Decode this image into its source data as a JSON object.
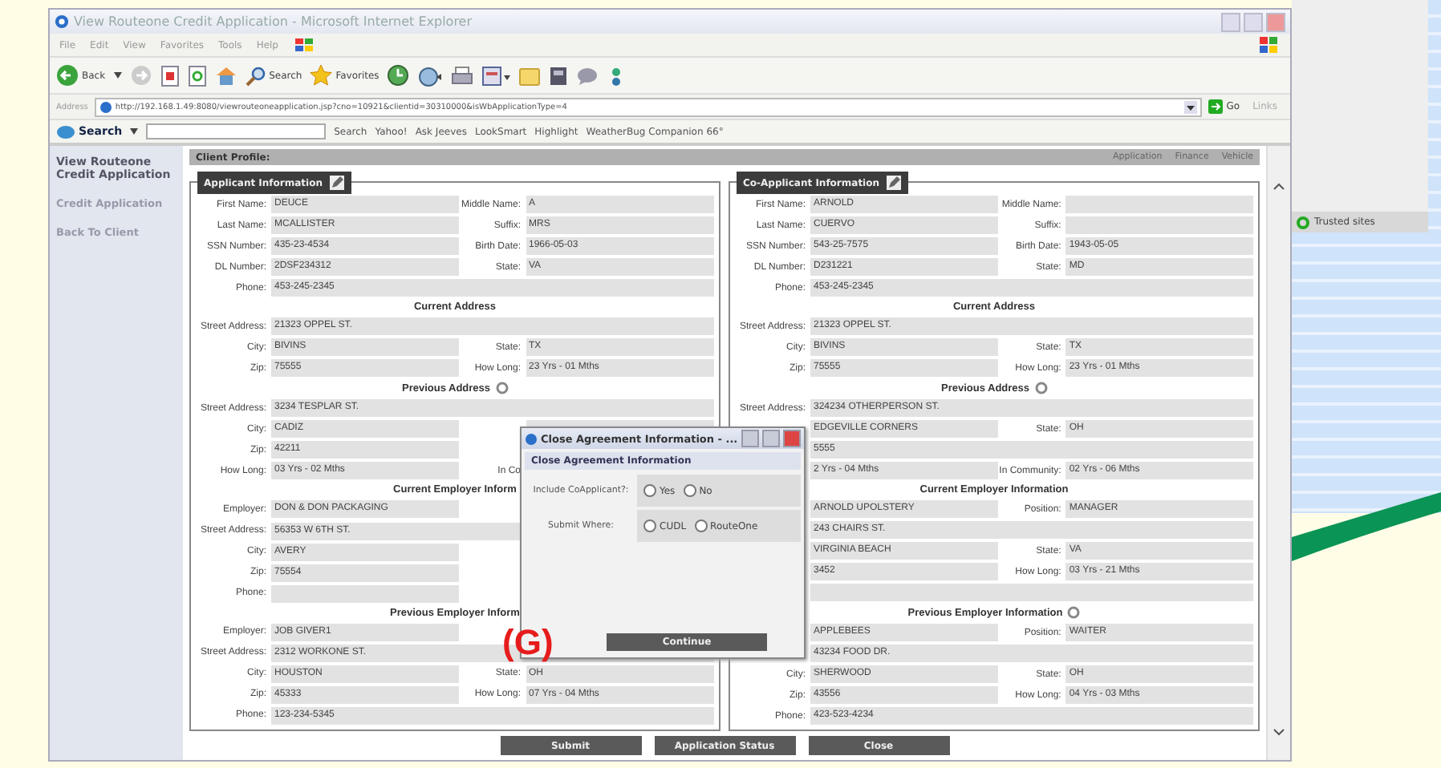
{
  "annotation": "(G)",
  "window": {
    "title": "View Routeone Credit Application - Microsoft Internet Explorer"
  },
  "menu": [
    "File",
    "Edit",
    "View",
    "Favorites",
    "Tools",
    "Help"
  ],
  "toolbar": {
    "back": "Back",
    "search": "Search",
    "favorites": "Favorites"
  },
  "address_bar": {
    "label": "Address",
    "url": "http://192.168.1.49:8080/viewrouteoneapplication.jsp?cno=10921&clientid=30310000&isWbApplicationType=4",
    "go": "Go",
    "links": "Links"
  },
  "search_toolbar": {
    "brand": "Search",
    "items": [
      "Search",
      "Yahoo!",
      "Ask Jeeves",
      "LookSmart",
      "Highlight",
      "WeatherBug Companion 66°"
    ]
  },
  "sidebar": {
    "title": "View Routeone Credit Application",
    "items": [
      {
        "label": "Credit Application"
      },
      {
        "label": "Back To Client"
      }
    ]
  },
  "header": {
    "title": "Client Profile:",
    "links": [
      "Application",
      "Finance",
      "Vehicle"
    ]
  },
  "panels": [
    {
      "title": "Applicant Information",
      "rows": [
        {
          "kind": "pair",
          "label": "First Name:",
          "value": "DEUCE",
          "label2": "Middle Name:",
          "value2": "A"
        },
        {
          "kind": "pair",
          "label": "Last Name:",
          "value": "MCALLISTER",
          "label2": "Suffix:",
          "value2": "MRS"
        },
        {
          "kind": "pair",
          "label": "SSN Number:",
          "value": "435-23-4534",
          "label2": "Birth Date:",
          "value2": "1966-05-03"
        },
        {
          "kind": "pair",
          "label": "DL Number:",
          "value": "2DSF234312",
          "label2": "State:",
          "value2": "VA"
        },
        {
          "kind": "single",
          "label": "Phone:",
          "value": "453-245-2345"
        },
        {
          "kind": "heading",
          "text": "Current Address",
          "has_icon": false
        },
        {
          "kind": "single",
          "label": "Street Address:",
          "value": "21323 OPPEL ST."
        },
        {
          "kind": "pair",
          "label": "City:",
          "value": "BIVINS",
          "label2": "State:",
          "value2": "TX"
        },
        {
          "kind": "pair",
          "label": "Zip:",
          "value": "75555",
          "label2": "How Long:",
          "value2": "23 Yrs - 01 Mths"
        },
        {
          "kind": "heading",
          "text": "Previous Address",
          "has_icon": true
        },
        {
          "kind": "single",
          "label": "Street Address:",
          "value": "3234 TESPLAR ST."
        },
        {
          "kind": "pair",
          "label": "City:",
          "value": "CADIZ"
        },
        {
          "kind": "pair",
          "label": "Zip:",
          "value": "42211"
        },
        {
          "kind": "pair",
          "label": "How Long:",
          "value": "03 Yrs - 02 Mths",
          "label2": "In Co"
        },
        {
          "kind": "heading",
          "text": "Current Employer Inform"
        },
        {
          "kind": "pair",
          "label": "Employer:",
          "value": "DON & DON PACKAGING"
        },
        {
          "kind": "single",
          "label": "Street Address:",
          "value": "56353 W 6TH ST."
        },
        {
          "kind": "pair",
          "label": "City:",
          "value": "AVERY"
        },
        {
          "kind": "pair",
          "label": "Zip:",
          "value": "75554"
        },
        {
          "kind": "pair",
          "label": "Phone:"
        },
        {
          "kind": "heading",
          "text": "Previous Employer Inform"
        },
        {
          "kind": "pair",
          "label": "Employer:",
          "value": "JOB GIVER1"
        },
        {
          "kind": "single",
          "label": "Street Address:",
          "value": "2312 WORKONE ST."
        },
        {
          "kind": "pair",
          "label": "City:",
          "value": "HOUSTON",
          "label2": "State:",
          "value2": "OH"
        },
        {
          "kind": "pair",
          "label": "Zip:",
          "value": "45333",
          "label2": "How Long:",
          "value2": "07 Yrs - 04 Mths"
        },
        {
          "kind": "single",
          "label": "Phone:",
          "value": "123-234-5345"
        }
      ]
    },
    {
      "title": "Co-Applicant Information",
      "rows": [
        {
          "kind": "pair",
          "label": "First Name:",
          "value": "ARNOLD",
          "label2": "Middle Name:"
        },
        {
          "kind": "pair",
          "label": "Last Name:",
          "value": "CUERVO",
          "label2": "Suffix:"
        },
        {
          "kind": "pair",
          "label": "SSN Number:",
          "value": "543-25-7575",
          "label2": "Birth Date:",
          "value2": "1943-05-05"
        },
        {
          "kind": "pair",
          "label": "DL Number:",
          "value": "D231221",
          "label2": "State:",
          "value2": "MD"
        },
        {
          "kind": "single",
          "label": "Phone:",
          "value": "453-245-2345"
        },
        {
          "kind": "heading",
          "text": "Current Address",
          "has_icon": false
        },
        {
          "kind": "single",
          "label": "Street Address:",
          "value": "21323 OPPEL ST."
        },
        {
          "kind": "pair",
          "label": "City:",
          "value": "BIVINS",
          "label2": "State:",
          "value2": "TX"
        },
        {
          "kind": "pair",
          "label": "Zip:",
          "value": "75555",
          "label2": "How Long:",
          "value2": "23 Yrs - 01 Mths"
        },
        {
          "kind": "heading",
          "text": "Previous Address",
          "has_icon": true
        },
        {
          "kind": "single",
          "label": "Street Address:",
          "value": "324234 OTHERPERSON ST."
        },
        {
          "kind": "pair",
          "value": "EDGEVILLE CORNERS",
          "label2": "State:",
          "value2": "OH"
        },
        {
          "kind": "single",
          "value": "5555"
        },
        {
          "kind": "pair",
          "value": "2 Yrs - 04 Mths",
          "label2": "In Community:",
          "value2": "02 Yrs - 06 Mths"
        },
        {
          "kind": "heading",
          "text": "Current Employer Information",
          "has_icon": false
        },
        {
          "kind": "pair",
          "value": "ARNOLD UPOLSTERY",
          "label2": "Position:",
          "value2": "MANAGER"
        },
        {
          "kind": "single",
          "value": "243 CHAIRS ST."
        },
        {
          "kind": "pair",
          "value": "VIRGINIA BEACH",
          "label2": "State:",
          "value2": "VA"
        },
        {
          "kind": "pair",
          "value": "3452",
          "label2": "How Long:",
          "value2": "03 Yrs - 21 Mths"
        },
        {
          "kind": "single"
        },
        {
          "kind": "heading",
          "text": "Previous Employer Information",
          "has_icon": true
        },
        {
          "kind": "pair",
          "value": "APPLEBEES",
          "label2": "Position:",
          "value2": "WAITER"
        },
        {
          "kind": "single",
          "value": "43234 FOOD DR."
        },
        {
          "kind": "pair",
          "label": "City:",
          "value": "SHERWOOD",
          "label2": "State:",
          "value2": "OH"
        },
        {
          "kind": "pair",
          "label": "Zip:",
          "value": "43556",
          "label2": "How Long:",
          "value2": "04 Yrs - 03 Mths"
        },
        {
          "kind": "single",
          "label": "Phone:",
          "value": "423-523-4234"
        }
      ]
    }
  ],
  "buttons": [
    "Submit",
    "Application Status",
    "Close"
  ],
  "dialog": {
    "title": "Close Agreement Information - ...",
    "header": "Close Agreement Information",
    "fields": [
      {
        "label": "Include CoApplicant?:",
        "options": [
          {
            "label": "Yes",
            "selected": false
          },
          {
            "label": "No",
            "selected": false
          }
        ]
      },
      {
        "label": "Submit Where:",
        "options": [
          {
            "label": "CUDL",
            "selected": false
          },
          {
            "label": "RouteOne",
            "selected": false
          }
        ]
      }
    ],
    "button": "Continue"
  },
  "background_window": {
    "status": "Trusted sites"
  }
}
